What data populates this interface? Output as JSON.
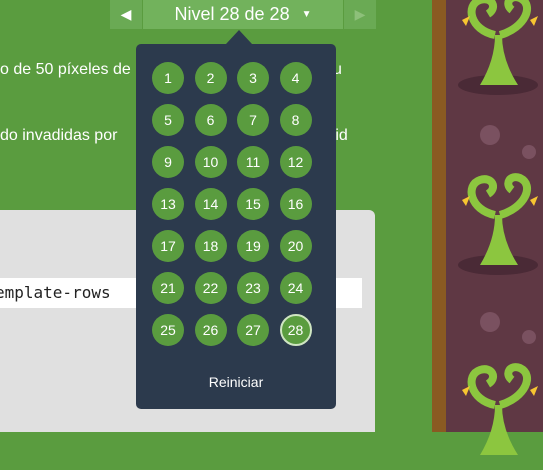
{
  "instructions": {
    "line1": "o de 50 píxeles de",
    "line1_tail": "u",
    "line2": "do invadidas por",
    "line2_tail": "rid"
  },
  "nav": {
    "title": "Nivel 28 de 28",
    "prev_icon": "chevron-left-icon",
    "next_icon": "chevron-right-icon",
    "caret_icon": "caret-down-icon"
  },
  "editor": {
    "code_line": "emplate-rows"
  },
  "level_menu": {
    "levels": [
      "1",
      "2",
      "3",
      "4",
      "5",
      "6",
      "7",
      "8",
      "9",
      "10",
      "11",
      "12",
      "13",
      "14",
      "15",
      "16",
      "17",
      "18",
      "19",
      "20",
      "21",
      "22",
      "23",
      "24",
      "25",
      "26",
      "27",
      "28"
    ],
    "current": "28",
    "reset_label": "Reiniciar"
  },
  "colors": {
    "background": "#5a9c3f",
    "menu_bg": "#2c3a4d",
    "level_circle": "#5a9c3f",
    "editor_bg": "#e0e0e0"
  }
}
